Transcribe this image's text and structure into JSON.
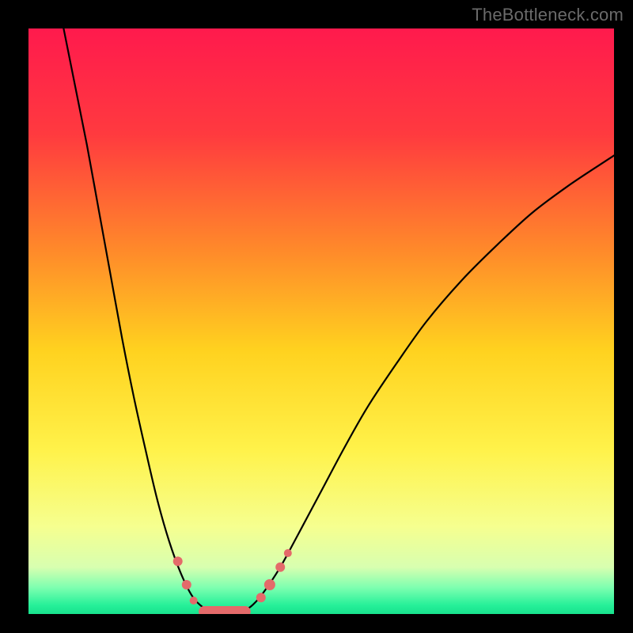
{
  "watermark": "TheBottleneck.com",
  "chart_data": {
    "type": "line",
    "title": "",
    "xlabel": "",
    "ylabel": "",
    "xlim": [
      0,
      100
    ],
    "ylim": [
      0,
      100
    ],
    "background_gradient": {
      "stops": [
        {
          "offset": 0.0,
          "color": "#ff1a4d"
        },
        {
          "offset": 0.18,
          "color": "#ff3a3f"
        },
        {
          "offset": 0.38,
          "color": "#ff8a2a"
        },
        {
          "offset": 0.55,
          "color": "#ffd21f"
        },
        {
          "offset": 0.72,
          "color": "#fff24a"
        },
        {
          "offset": 0.85,
          "color": "#f6ff8f"
        },
        {
          "offset": 0.92,
          "color": "#d8ffb0"
        },
        {
          "offset": 0.955,
          "color": "#7dffb0"
        },
        {
          "offset": 0.985,
          "color": "#26f099"
        },
        {
          "offset": 1.0,
          "color": "#18e28d"
        }
      ]
    },
    "series": [
      {
        "name": "bottleneck-curve",
        "color": "#000000",
        "width": 2.2,
        "points": [
          {
            "x": 6.0,
            "y": 100.0
          },
          {
            "x": 8.0,
            "y": 90.0
          },
          {
            "x": 10.0,
            "y": 80.0
          },
          {
            "x": 12.0,
            "y": 69.0
          },
          {
            "x": 14.0,
            "y": 58.0
          },
          {
            "x": 16.0,
            "y": 47.0
          },
          {
            "x": 18.0,
            "y": 37.0
          },
          {
            "x": 20.0,
            "y": 28.0
          },
          {
            "x": 22.0,
            "y": 19.5
          },
          {
            "x": 24.0,
            "y": 12.5
          },
          {
            "x": 26.0,
            "y": 7.0
          },
          {
            "x": 28.0,
            "y": 3.0
          },
          {
            "x": 30.0,
            "y": 1.0
          },
          {
            "x": 32.0,
            "y": 0.2
          },
          {
            "x": 34.0,
            "y": 0.0
          },
          {
            "x": 36.0,
            "y": 0.2
          },
          {
            "x": 38.0,
            "y": 1.3
          },
          {
            "x": 40.0,
            "y": 3.5
          },
          {
            "x": 43.0,
            "y": 8.0
          },
          {
            "x": 46.0,
            "y": 13.5
          },
          {
            "x": 50.0,
            "y": 21.0
          },
          {
            "x": 54.0,
            "y": 28.5
          },
          {
            "x": 58.0,
            "y": 35.5
          },
          {
            "x": 63.0,
            "y": 43.0
          },
          {
            "x": 68.0,
            "y": 50.0
          },
          {
            "x": 74.0,
            "y": 57.0
          },
          {
            "x": 80.0,
            "y": 63.0
          },
          {
            "x": 86.0,
            "y": 68.5
          },
          {
            "x": 92.0,
            "y": 73.0
          },
          {
            "x": 98.0,
            "y": 77.0
          },
          {
            "x": 100.0,
            "y": 78.3
          }
        ]
      }
    ],
    "markers": {
      "color": "#e46a6a",
      "radius_default": 6,
      "points": [
        {
          "x": 25.5,
          "y": 9.0,
          "r": 6
        },
        {
          "x": 27.0,
          "y": 5.0,
          "r": 6
        },
        {
          "x": 28.2,
          "y": 2.3,
          "r": 5
        },
        {
          "x": 30.0,
          "y": 0.4,
          "r": 7,
          "capsule_to": {
            "x": 37.0,
            "y": 0.4
          }
        },
        {
          "x": 39.7,
          "y": 2.8,
          "r": 6
        },
        {
          "x": 41.2,
          "y": 5.0,
          "r": 7
        },
        {
          "x": 43.0,
          "y": 8.0,
          "r": 6
        },
        {
          "x": 44.3,
          "y": 10.4,
          "r": 5
        }
      ]
    }
  }
}
